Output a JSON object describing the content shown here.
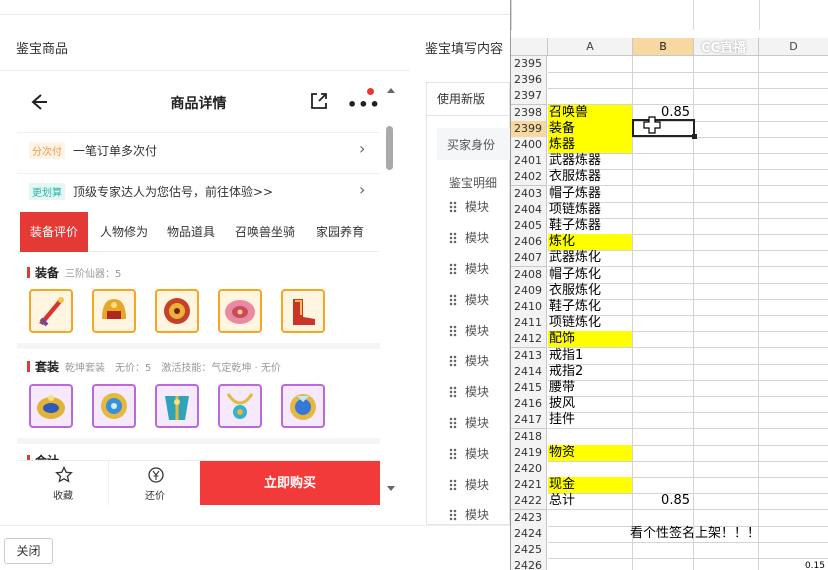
{
  "left": {
    "section_title": "鉴宝商品",
    "section_title_right": "鉴宝填写内容",
    "close_label": "关闭"
  },
  "phone": {
    "header_title": "商品详情",
    "more_glyph": "•••",
    "rows": [
      {
        "tag": "分次付",
        "text": "一笔订单多次付",
        "tag_color": "orange"
      },
      {
        "tag": "更划算",
        "text": "顶级专家达人为您估号，前往体验>>",
        "tag_color": "teal"
      }
    ],
    "tabs": [
      "装备评价",
      "人物修为",
      "物品道具",
      "召唤兽坐骑",
      "家园养育"
    ],
    "active_tab": 0,
    "sections": [
      {
        "name": "装备",
        "sub": "三阶仙器：5",
        "items": [
          "weapon-sword",
          "helmet-gold",
          "necklace-gold",
          "armor-pink",
          "boots-gold"
        ]
      },
      {
        "name": "套装",
        "sub": "乾坤套装　无价：5　激活技能：气定乾坤 · 无价",
        "items": [
          "ring-gold",
          "ring-blue",
          "armor-blue",
          "necklace-blue",
          "ring-gem"
        ]
      },
      {
        "name": "会计",
        "sub": "",
        "items": []
      }
    ],
    "footer": {
      "favorite": "收藏",
      "bargain": "还价",
      "buy": "立即购买"
    }
  },
  "middle": {
    "tab": "使用新版",
    "buyer": "买家身份",
    "detail": "鉴宝明细",
    "rows": [
      "模块",
      "模块",
      "模块",
      "模块",
      "模块",
      "模块",
      "模块",
      "模块",
      "模块",
      "模块",
      "模块"
    ]
  },
  "excel": {
    "columns": [
      "A",
      "B",
      "C",
      "D"
    ],
    "watermark": "CC直播",
    "rows": [
      {
        "n": "2395",
        "a": "",
        "b": "",
        "hl": false
      },
      {
        "n": "2396",
        "a": "",
        "b": "",
        "hl": false
      },
      {
        "n": "2397",
        "a": "",
        "b": "",
        "hl": false
      },
      {
        "n": "2398",
        "a": "召唤兽",
        "b": "0.85",
        "hl": true
      },
      {
        "n": "2399",
        "a": "装备",
        "b": "",
        "hl": true,
        "sel": true
      },
      {
        "n": "2400",
        "a": "炼器",
        "b": "",
        "hl": true
      },
      {
        "n": "2401",
        "a": "武器炼器",
        "b": "",
        "hl": false
      },
      {
        "n": "2402",
        "a": "衣服炼器",
        "b": "",
        "hl": false
      },
      {
        "n": "2403",
        "a": "帽子炼器",
        "b": "",
        "hl": false
      },
      {
        "n": "2404",
        "a": "项链炼器",
        "b": "",
        "hl": false
      },
      {
        "n": "2405",
        "a": "鞋子炼器",
        "b": "",
        "hl": false
      },
      {
        "n": "2406",
        "a": "炼化",
        "b": "",
        "hl": true
      },
      {
        "n": "2407",
        "a": "武器炼化",
        "b": "",
        "hl": false
      },
      {
        "n": "2408",
        "a": "帽子炼化",
        "b": "",
        "hl": false
      },
      {
        "n": "2409",
        "a": "衣服炼化",
        "b": "",
        "hl": false
      },
      {
        "n": "2410",
        "a": "鞋子炼化",
        "b": "",
        "hl": false
      },
      {
        "n": "2411",
        "a": "项链炼化",
        "b": "",
        "hl": false
      },
      {
        "n": "2412",
        "a": "配饰",
        "b": "",
        "hl": true
      },
      {
        "n": "2413",
        "a": "戒指1",
        "b": "",
        "hl": false
      },
      {
        "n": "2414",
        "a": "戒指2",
        "b": "",
        "hl": false
      },
      {
        "n": "2415",
        "a": "腰带",
        "b": "",
        "hl": false
      },
      {
        "n": "2416",
        "a": "披风",
        "b": "",
        "hl": false
      },
      {
        "n": "2417",
        "a": "挂件",
        "b": "",
        "hl": false
      },
      {
        "n": "2418",
        "a": "",
        "b": "",
        "hl": false
      },
      {
        "n": "2419",
        "a": "物资",
        "b": "",
        "hl": true
      },
      {
        "n": "2420",
        "a": "",
        "b": "",
        "hl": false
      },
      {
        "n": "2421",
        "a": "现金",
        "b": "",
        "hl": true
      },
      {
        "n": "2422",
        "a": "总计",
        "b": "0.85",
        "hl": false
      },
      {
        "n": "2423",
        "a": "",
        "b": "",
        "hl": false
      },
      {
        "n": "2424",
        "a": "",
        "b": "",
        "hl": false,
        "merged": "看个性签名上架！！！"
      },
      {
        "n": "2425",
        "a": "",
        "b": "",
        "hl": false
      },
      {
        "n": "2426",
        "a": "",
        "b": "",
        "hl": false,
        "d": "0.15"
      }
    ],
    "colors": {
      "highlight": "#ffff00",
      "header_selected": "#f7d8a0",
      "accent": "#e53935"
    }
  }
}
